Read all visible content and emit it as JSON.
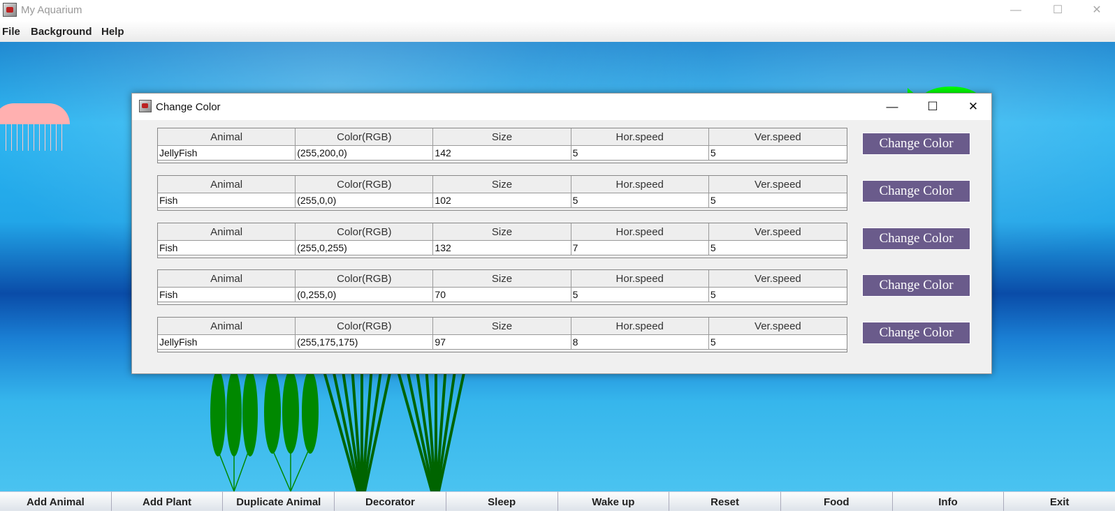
{
  "window": {
    "title": "My Aquarium",
    "controls": {
      "minimize": "—",
      "maximize": "☐",
      "close": "✕"
    }
  },
  "menu": [
    "File",
    "Background",
    "Help"
  ],
  "dialog": {
    "title": "Change Color",
    "controls": {
      "minimize": "—",
      "maximize": "☐",
      "close": "✕"
    },
    "columns": [
      "Animal",
      "Color(RGB)",
      "Size",
      "Hor.speed",
      "Ver.speed"
    ],
    "rows": [
      {
        "animal": "JellyFish",
        "color": "(255,200,0)",
        "size": "142",
        "hor": "5",
        "ver": "5",
        "button": "Change Color"
      },
      {
        "animal": "Fish",
        "color": "(255,0,0)",
        "size": "102",
        "hor": "5",
        "ver": "5",
        "button": "Change Color"
      },
      {
        "animal": "Fish",
        "color": "(255,0,255)",
        "size": "132",
        "hor": "7",
        "ver": "5",
        "button": "Change Color"
      },
      {
        "animal": "Fish",
        "color": "(0,255,0)",
        "size": "70",
        "hor": "5",
        "ver": "5",
        "button": "Change Color"
      },
      {
        "animal": "JellyFish",
        "color": "(255,175,175)",
        "size": "97",
        "hor": "8",
        "ver": "5",
        "button": "Change Color"
      }
    ]
  },
  "bottom_buttons": [
    "Add Animal",
    "Add Plant",
    "Duplicate Animal",
    "Decorator",
    "Sleep",
    "Wake up",
    "Reset",
    "Food",
    "Info",
    "Exit"
  ],
  "colors": {
    "button_purple": "#6a5b8b",
    "fish_green": "#00ff00",
    "jelly_pink": "#ffb0b0",
    "plant_green": "#008800",
    "plant_dark": "#006400"
  }
}
